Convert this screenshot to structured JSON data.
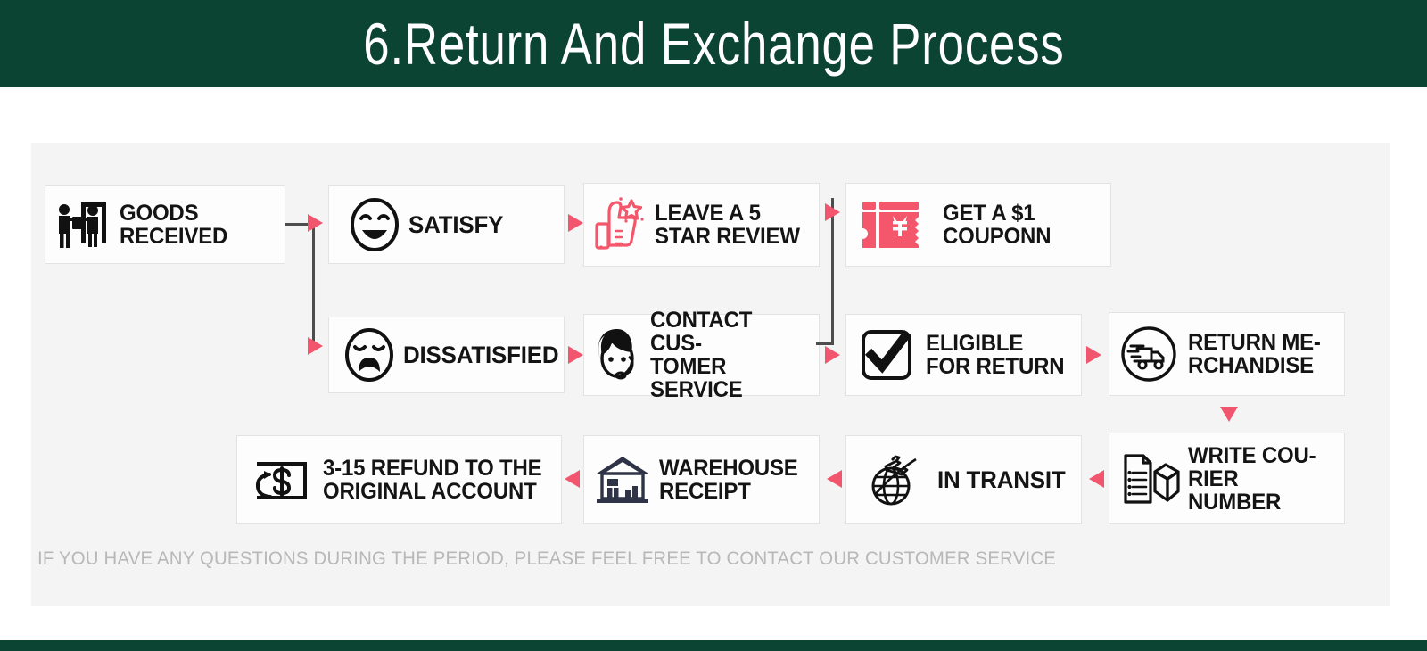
{
  "header": {
    "title": "6.Return And Exchange Process",
    "bg_color": "#0c4434",
    "text_color": "#ffffff"
  },
  "footer": {
    "bg_color": "#0c4434"
  },
  "panel": {
    "bg_color": "#f4f4f4"
  },
  "accent": {
    "arrow_color": "#f2566e",
    "icon_red": "#f4566b",
    "connector_color": "#4d4d4d",
    "box_bg": "#fdfdfd",
    "box_border": "#e3e3e3"
  },
  "flow": {
    "steps": [
      {
        "id": "goods-received",
        "label": "GOODS\nRECEIVED",
        "icon": "delivery-handoff-icon"
      },
      {
        "id": "satisfy",
        "label": "SATISFY",
        "icon": "happy-face-icon"
      },
      {
        "id": "leave-review",
        "label": "LEAVE A 5\nSTAR REVIEW",
        "icon": "thumbs-up-star-icon"
      },
      {
        "id": "get-coupon",
        "label": "GET A $1\nCOUPONN",
        "icon": "coupon-ticket-icon"
      },
      {
        "id": "dissatisfied",
        "label": "DISSATISFIED",
        "icon": "sad-face-icon"
      },
      {
        "id": "contact-service",
        "label": "CONTACT CUS-\nTOMER SERVICE",
        "icon": "support-agent-icon"
      },
      {
        "id": "eligible-return",
        "label": "ELIGIBLE\nFOR RETURN",
        "icon": "checkbox-check-icon"
      },
      {
        "id": "return-merch",
        "label": "RETURN ME-\nRCHANDISE",
        "icon": "return-truck-icon"
      },
      {
        "id": "write-courier",
        "label": "WRITE COU-\nRIER NUMBER",
        "icon": "document-package-icon"
      },
      {
        "id": "in-transit",
        "label": "IN TRANSIT",
        "icon": "airplane-globe-icon"
      },
      {
        "id": "warehouse",
        "label": "WAREHOUSE\nRECEIPT",
        "icon": "warehouse-icon"
      },
      {
        "id": "refund",
        "label": "3-15 REFUND TO THE\nORIGINAL ACCOUNT",
        "icon": "refund-dollar-icon"
      }
    ]
  },
  "note": {
    "text": "IF YOU HAVE ANY QUESTIONS DURING THE PERIOD, PLEASE FEEL FREE TO CONTACT OUR CUSTOMER SERVICE"
  }
}
